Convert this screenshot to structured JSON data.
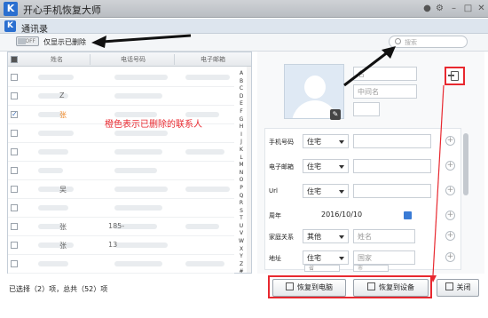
{
  "app": {
    "title": "开心手机恢复大师",
    "logo": "K"
  },
  "window": {
    "title": "通讯录",
    "logo": "K"
  },
  "toolbar": {
    "toggle_text": "OFF",
    "toggle_label": "仅显示已删除",
    "search_placeholder": "搜索"
  },
  "table": {
    "headers": [
      "姓名",
      "电话号码",
      "电子邮箱"
    ],
    "rows": [
      {
        "name": "",
        "phone": "",
        "email": "",
        "deleted": false,
        "checked": false
      },
      {
        "name": "Z",
        "phone": "",
        "email": "",
        "deleted": false,
        "checked": false
      },
      {
        "name": "张",
        "phone": "",
        "email": "",
        "deleted": true,
        "checked": true
      },
      {
        "name": "",
        "phone": "",
        "email": "",
        "deleted": false,
        "checked": false
      },
      {
        "name": "",
        "phone": "",
        "email": "",
        "deleted": false,
        "checked": false
      },
      {
        "name": "",
        "phone": "",
        "email": "",
        "deleted": false,
        "checked": false
      },
      {
        "name": "吴",
        "phone": "",
        "email": "",
        "deleted": false,
        "checked": false
      },
      {
        "name": "",
        "phone": "",
        "email": "",
        "deleted": false,
        "checked": false
      },
      {
        "name": "张",
        "phone": "185-",
        "email": "",
        "deleted": false,
        "checked": false
      },
      {
        "name": "张",
        "phone": "13",
        "email": "",
        "deleted": false,
        "checked": false
      },
      {
        "name": "",
        "phone": "",
        "email": "",
        "deleted": false,
        "checked": false
      }
    ],
    "alphabet": [
      "A",
      "B",
      "C",
      "D",
      "E",
      "F",
      "G",
      "H",
      "I",
      "J",
      "K",
      "L",
      "M",
      "N",
      "O",
      "P",
      "Q",
      "R",
      "S",
      "T",
      "U",
      "V",
      "W",
      "X",
      "Y",
      "Z",
      "#"
    ]
  },
  "annotation": "橙色表示已删除的联系人",
  "status": "已选择（2）项，总共（52）项",
  "detail": {
    "fields": {
      "first_name": "名",
      "middle_name": "中间名",
      "last_name": ""
    },
    "form": [
      {
        "label": "手机号码",
        "type": "住宅",
        "value": ""
      },
      {
        "label": "电子邮箱",
        "type": "住宅",
        "value": ""
      },
      {
        "label": "Url",
        "type": "住宅",
        "value": ""
      },
      {
        "label": "周年",
        "type": "",
        "value": "2016/10/10"
      },
      {
        "label": "家庭关系",
        "type": "其他",
        "value": "姓名"
      },
      {
        "label": "地址",
        "type": "住宅",
        "value": "国家"
      }
    ],
    "addr_extra_1": "省",
    "addr_extra_2": "市"
  },
  "buttons": {
    "restore_pc": "恢复到电脑",
    "restore_device": "恢复到设备",
    "close": "关闭"
  },
  "colors": {
    "deleted": "#f08a2a",
    "highlight": "#e8282f",
    "brand": "#2a6fd0"
  }
}
